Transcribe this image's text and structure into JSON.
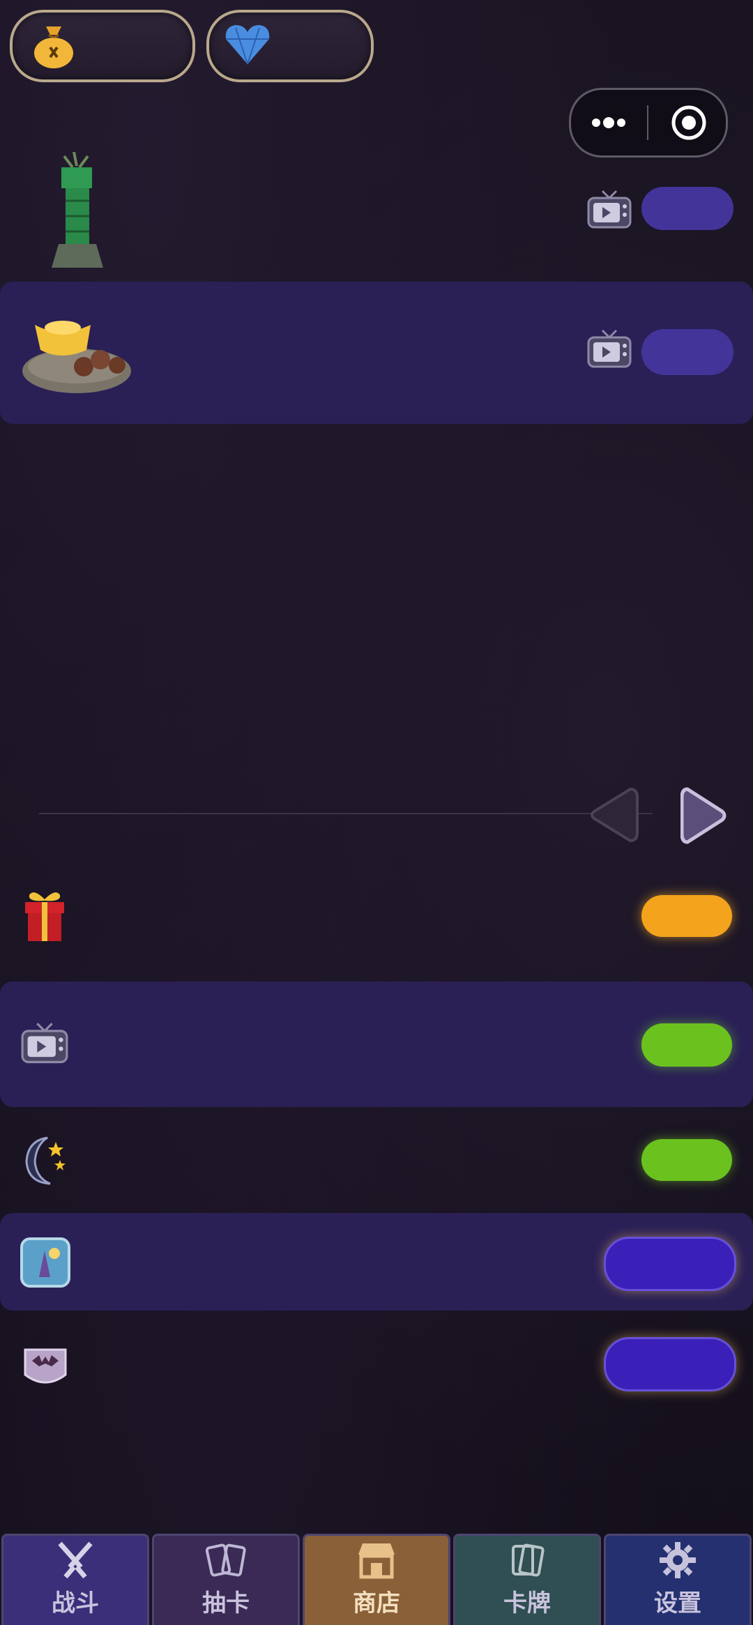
{
  "header": {
    "gold_icon": "money-bag-icon",
    "gem_icon": "blue-heart-gem-icon",
    "gold_value": "",
    "gem_value": "",
    "capsule": {
      "more_icon": "more-dots-icon",
      "close_icon": "target-close-icon"
    }
  },
  "shop_items": [
    {
      "icon": "green-tower-icon",
      "ad_icon": "tv-play-icon",
      "button_label": ""
    },
    {
      "icon": "gold-ingot-coins-icon",
      "ad_icon": "tv-play-icon",
      "button_label": ""
    }
  ],
  "pager": {
    "prev_icon": "arrow-left-icon",
    "next_icon": "arrow-right-icon"
  },
  "tasks": [
    {
      "icon": "gift-box-icon",
      "button_color": "#f4a41c",
      "button_label": ""
    },
    {
      "icon": "tv-play-icon",
      "button_color": "#6bc21f",
      "button_label": ""
    },
    {
      "icon": "moon-stars-icon",
      "button_color": "#6bc21f",
      "button_label": ""
    },
    {
      "icon": "wizard-card-icon",
      "button_color": "#3a20b8",
      "button_label": ""
    },
    {
      "icon": "bats-scroll-icon",
      "button_color": "#3a20b8",
      "button_label": ""
    }
  ],
  "nav": {
    "items": [
      {
        "label": "战斗",
        "icon": "crossed-swords-icon",
        "color": "#3b2f7a"
      },
      {
        "label": "抽卡",
        "icon": "cards-icon",
        "color": "#3a2a55"
      },
      {
        "label": "商店",
        "icon": "shop-icon",
        "color": "#8a6038"
      },
      {
        "label": "卡牌",
        "icon": "card-deck-icon",
        "color": "#2f4f52"
      },
      {
        "label": "设置",
        "icon": "gear-icon",
        "color": "#243070"
      }
    ],
    "active": "商店"
  }
}
